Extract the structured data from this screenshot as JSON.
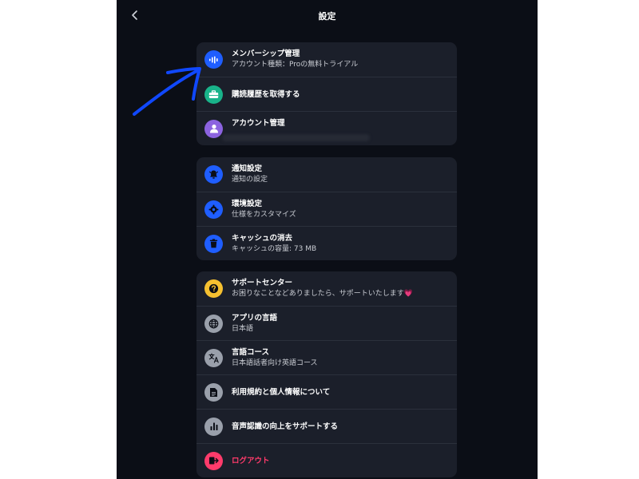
{
  "header": {
    "title": "設定",
    "back_icon": "chevron-left-icon"
  },
  "groups": [
    {
      "items": [
        {
          "label": "メンバーシップ管理",
          "sub": "アカウント種類：Proの無料トライアル",
          "icon": "audio-wave-icon",
          "icon_color": "#1f5eff"
        },
        {
          "label": "購読履歴を取得する",
          "icon": "briefcase-icon",
          "icon_color": "#19b38a"
        },
        {
          "label": "アカウント管理",
          "icon": "person-icon",
          "icon_color": "#8c63e0"
        }
      ]
    },
    {
      "items": [
        {
          "label": "通知設定",
          "sub": "通知の設定",
          "icon": "bell-icon",
          "icon_color": "#1f5eff"
        },
        {
          "label": "環境設定",
          "sub": "仕様をカスタマイズ",
          "icon": "gear-icon",
          "icon_color": "#1f5eff"
        },
        {
          "label": "キャッシュの消去",
          "sub": "キャッシュの容量: 73 MB",
          "icon": "trash-icon",
          "icon_color": "#1f5eff"
        }
      ]
    },
    {
      "items": [
        {
          "label": "サポートセンター",
          "sub": "お困りなことなどありましたら、サポートいたします💗",
          "icon": "question-icon",
          "icon_color": "#f5c030"
        },
        {
          "label": "アプリの言語",
          "sub": "日本語",
          "icon": "globe-icon",
          "icon_color": "#9aa0ab"
        },
        {
          "label": "言語コース",
          "sub": "日本語話者向け英語コース",
          "icon": "translate-icon",
          "icon_color": "#9aa0ab"
        },
        {
          "label": "利用規約と個人情報について",
          "icon": "document-icon",
          "icon_color": "#9aa0ab"
        },
        {
          "label": "音声認識の向上をサポートする",
          "icon": "bar-chart-icon",
          "icon_color": "#9aa0ab"
        },
        {
          "label": "ログアウト",
          "icon": "logout-icon",
          "icon_color": "#ff3b6b"
        }
      ]
    }
  ],
  "annotation": {
    "icon": "blue-arrow-icon",
    "color": "#1048ff"
  }
}
